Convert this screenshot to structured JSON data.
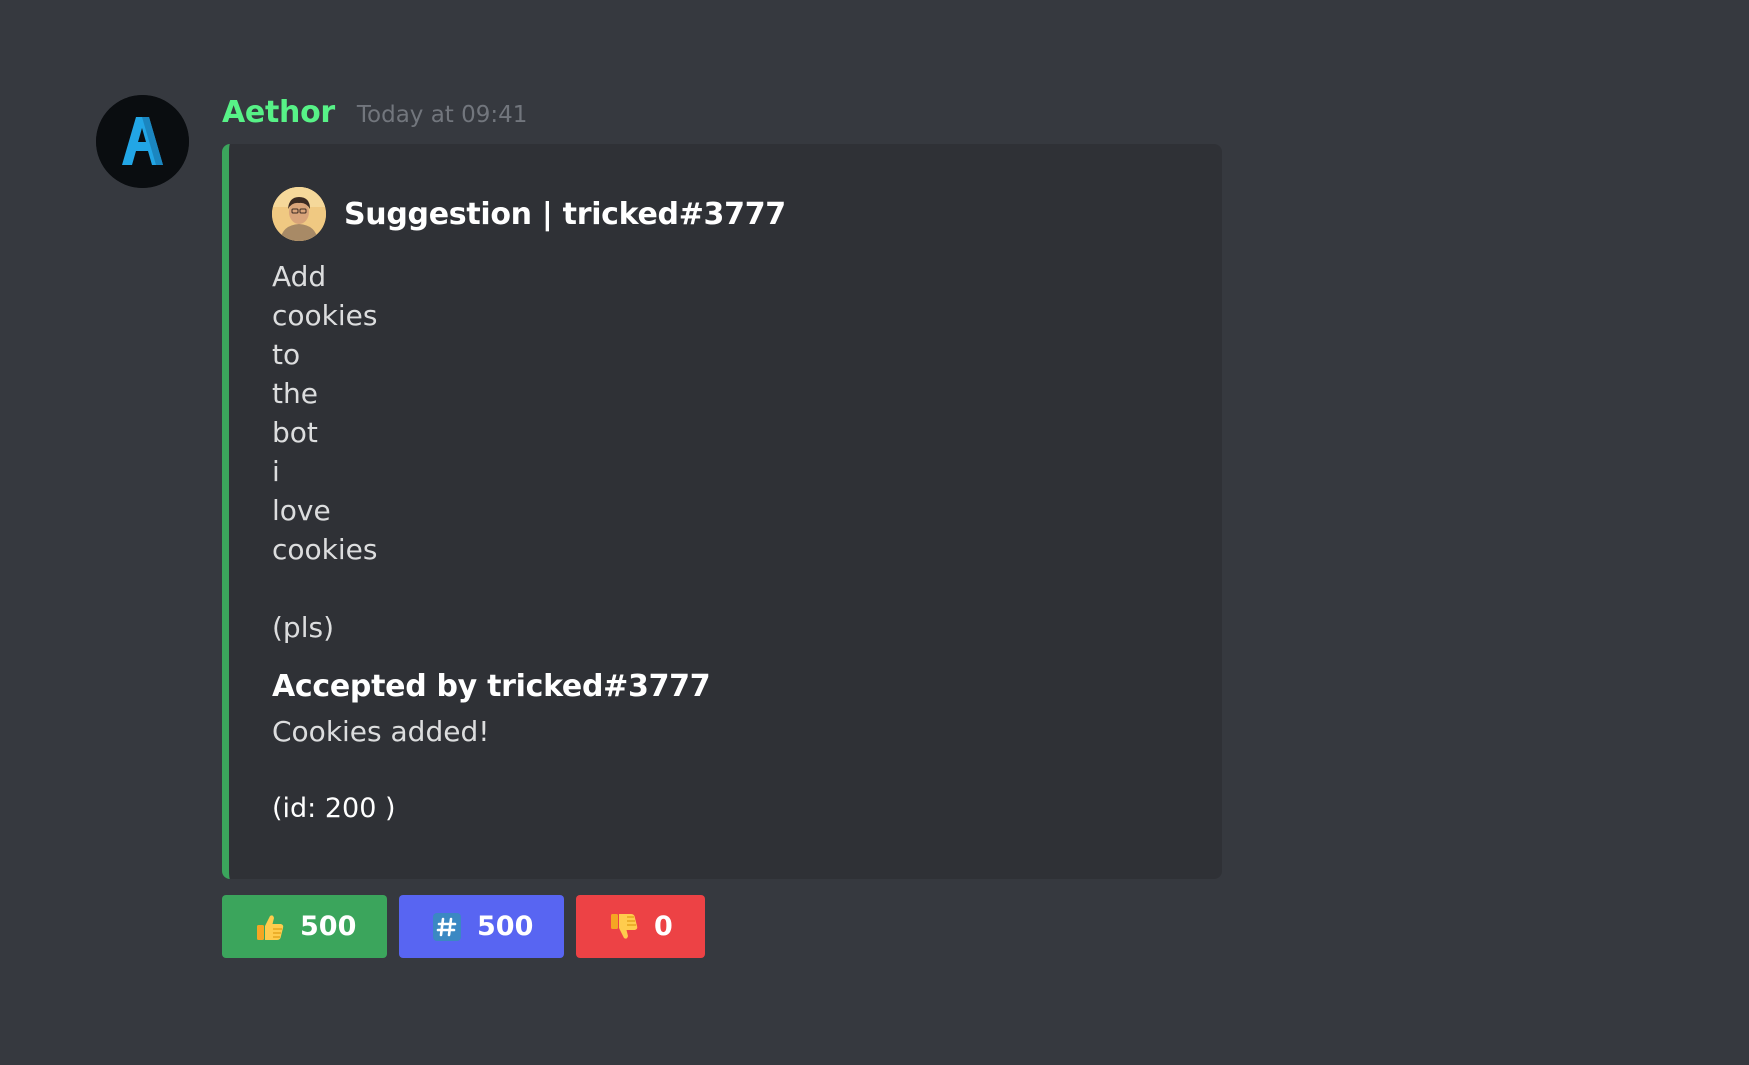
{
  "message": {
    "author": "Aethor",
    "timestamp": "Today at 09:41",
    "avatar_icon": "aethor-logo-icon",
    "username_color": "#57f287"
  },
  "embed": {
    "accent_color": "#3ba55c",
    "author_name": "Suggestion | tricked#3777",
    "author_avatar_icon": "user-portrait-icon",
    "description_lines": [
      "Add",
      "cookies",
      "to",
      "the",
      "bot",
      "i",
      "love",
      "cookies",
      "",
      "(pls)"
    ],
    "field": {
      "name": "Accepted by tricked#3777",
      "value": "Cookies added!"
    },
    "footer": "(id: 200 )"
  },
  "buttons": [
    {
      "icon": "thumbs-up-icon",
      "count": "500",
      "color": "#3ba55c"
    },
    {
      "icon": "hash-icon",
      "count": "500",
      "color": "#5865f2"
    },
    {
      "icon": "thumbs-down-icon",
      "count": "0",
      "color": "#ed4245"
    }
  ]
}
